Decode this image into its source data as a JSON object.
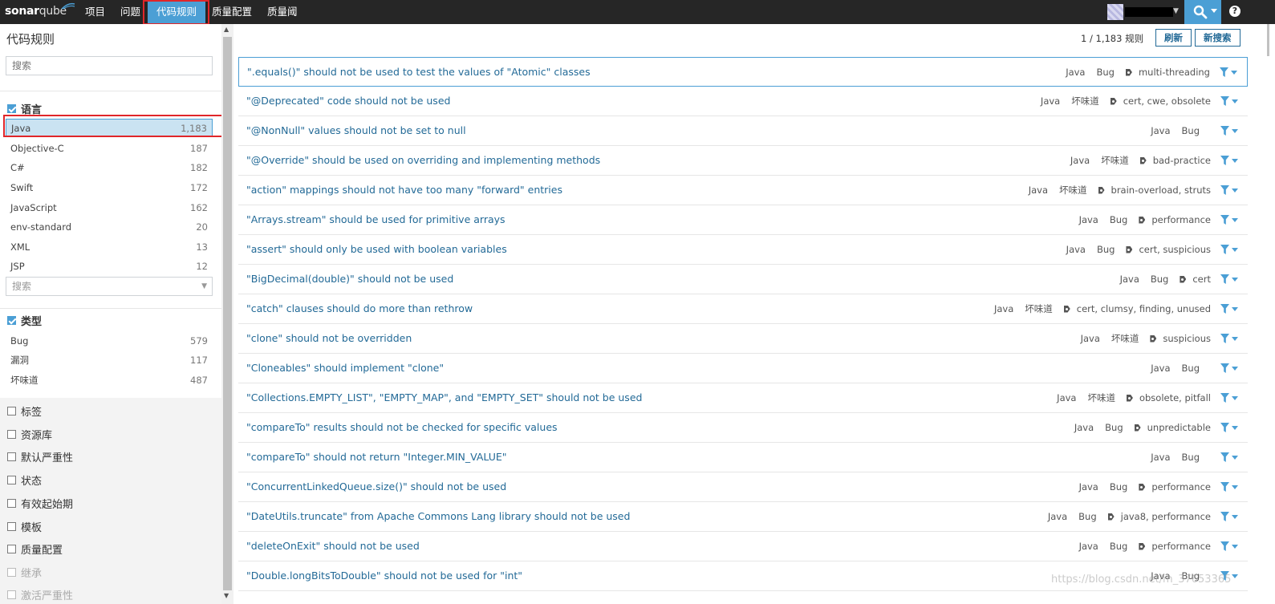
{
  "topbar": {
    "logo_bold": "sonar",
    "logo_light": "qube",
    "nav": [
      "项目",
      "问题",
      "代码规则",
      "质量配置",
      "质量阈"
    ],
    "active_nav": "代码规则",
    "help": "?"
  },
  "sidebar": {
    "title": "代码规则",
    "search_placeholder": "搜索",
    "language_facet": {
      "label": "语言",
      "items": [
        {
          "label": "Java",
          "count": "1,183"
        },
        {
          "label": "Objective-C",
          "count": "187"
        },
        {
          "label": "C#",
          "count": "182"
        },
        {
          "label": "Swift",
          "count": "172"
        },
        {
          "label": "JavaScript",
          "count": "162"
        },
        {
          "label": "env-standard",
          "count": "20"
        },
        {
          "label": "XML",
          "count": "13"
        },
        {
          "label": "JSP",
          "count": "12"
        }
      ],
      "search_placeholder": "搜索"
    },
    "type_facet": {
      "label": "类型",
      "items": [
        {
          "label": "Bug",
          "count": "579"
        },
        {
          "label": "漏洞",
          "count": "117"
        },
        {
          "label": "坏味道",
          "count": "487"
        }
      ]
    },
    "collapsed_facets": [
      "标签",
      "资源库",
      "默认严重性",
      "状态",
      "有效起始期",
      "模板",
      "质量配置",
      "继承",
      "激活严重性"
    ]
  },
  "main": {
    "counter": "1 / 1,183 规则",
    "refresh_label": "刷新",
    "new_search_label": "新搜索",
    "rules": [
      {
        "name": "\".equals()\" should not be used to test the values of \"Atomic\" classes",
        "lang": "Java",
        "type": "Bug",
        "tags": "multi-threading"
      },
      {
        "name": "\"@Deprecated\" code should not be used",
        "lang": "Java",
        "type": "坏味道",
        "tags": "cert, cwe, obsolete"
      },
      {
        "name": "\"@NonNull\" values should not be set to null",
        "lang": "Java",
        "type": "Bug",
        "tags": ""
      },
      {
        "name": "\"@Override\" should be used on overriding and implementing methods",
        "lang": "Java",
        "type": "坏味道",
        "tags": "bad-practice"
      },
      {
        "name": "\"action\" mappings should not have too many \"forward\" entries",
        "lang": "Java",
        "type": "坏味道",
        "tags": "brain-overload, struts"
      },
      {
        "name": "\"Arrays.stream\" should be used for primitive arrays",
        "lang": "Java",
        "type": "Bug",
        "tags": "performance"
      },
      {
        "name": "\"assert\" should only be used with boolean variables",
        "lang": "Java",
        "type": "Bug",
        "tags": "cert, suspicious"
      },
      {
        "name": "\"BigDecimal(double)\" should not be used",
        "lang": "Java",
        "type": "Bug",
        "tags": "cert"
      },
      {
        "name": "\"catch\" clauses should do more than rethrow",
        "lang": "Java",
        "type": "坏味道",
        "tags": "cert, clumsy, finding, unused"
      },
      {
        "name": "\"clone\" should not be overridden",
        "lang": "Java",
        "type": "坏味道",
        "tags": "suspicious"
      },
      {
        "name": "\"Cloneables\" should implement \"clone\"",
        "lang": "Java",
        "type": "Bug",
        "tags": ""
      },
      {
        "name": "\"Collections.EMPTY_LIST\", \"EMPTY_MAP\", and \"EMPTY_SET\" should not be used",
        "lang": "Java",
        "type": "坏味道",
        "tags": "obsolete, pitfall"
      },
      {
        "name": "\"compareTo\" results should not be checked for specific values",
        "lang": "Java",
        "type": "Bug",
        "tags": "unpredictable"
      },
      {
        "name": "\"compareTo\" should not return \"Integer.MIN_VALUE\"",
        "lang": "Java",
        "type": "Bug",
        "tags": ""
      },
      {
        "name": "\"ConcurrentLinkedQueue.size()\" should not be used",
        "lang": "Java",
        "type": "Bug",
        "tags": "performance"
      },
      {
        "name": "\"DateUtils.truncate\" from Apache Commons Lang library should not be used",
        "lang": "Java",
        "type": "Bug",
        "tags": "java8, performance"
      },
      {
        "name": "\"deleteOnExit\" should not be used",
        "lang": "Java",
        "type": "Bug",
        "tags": "performance"
      },
      {
        "name": "\"Double.longBitsToDouble\" should not be used for \"int\"",
        "lang": "Java",
        "type": "Bug",
        "tags": ""
      }
    ]
  },
  "watermark": "https://blog.csdn.net/m_37653365",
  "colors": {
    "topbar": "#262626",
    "accent": "#4b9fd5",
    "link": "#236a97",
    "highlight_box": "#e0262a"
  }
}
